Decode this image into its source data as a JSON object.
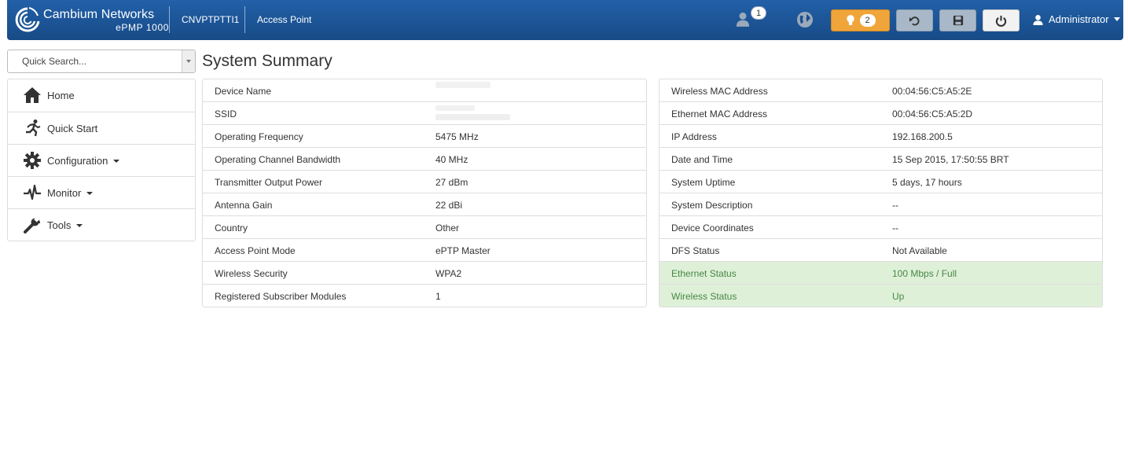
{
  "header": {
    "brand_name": "Cambium Networks",
    "brand_model": "ePMP 1000",
    "device_id": "CNVPTPTTI1",
    "device_mode": "Access Point",
    "connected_users_count": "1",
    "alerts_count": "2",
    "user_label": "Administrator",
    "colors": {
      "bar": "#1d4f8f",
      "alert_button": "#f0a53a",
      "action_button": "#a9b8c8"
    }
  },
  "search": {
    "placeholder": "Quick Search..."
  },
  "nav": {
    "items": [
      {
        "label": "Home",
        "icon": "home-icon",
        "has_dropdown": false
      },
      {
        "label": "Quick Start",
        "icon": "running-man-icon",
        "has_dropdown": false
      },
      {
        "label": "Configuration",
        "icon": "gear-icon",
        "has_dropdown": true
      },
      {
        "label": "Monitor",
        "icon": "pulse-icon",
        "has_dropdown": true
      },
      {
        "label": "Tools",
        "icon": "wrench-icon",
        "has_dropdown": true
      }
    ]
  },
  "main": {
    "title": "System Summary",
    "left_table": [
      {
        "key": "Device Name",
        "value": ""
      },
      {
        "key": "SSID",
        "value": ""
      },
      {
        "key": "Operating Frequency",
        "value": "5475 MHz"
      },
      {
        "key": "Operating Channel Bandwidth",
        "value": "40 MHz"
      },
      {
        "key": "Transmitter Output Power",
        "value": "27 dBm"
      },
      {
        "key": "Antenna Gain",
        "value": "22 dBi"
      },
      {
        "key": "Country",
        "value": "Other"
      },
      {
        "key": "Access Point Mode",
        "value": "ePTP Master"
      },
      {
        "key": "Wireless Security",
        "value": "WPA2"
      },
      {
        "key": "Registered Subscriber Modules",
        "value": "1"
      }
    ],
    "right_table": [
      {
        "key": "Wireless MAC Address",
        "value": "00:04:56:C5:A5:2E"
      },
      {
        "key": "Ethernet MAC Address",
        "value": "00:04:56:C5:A5:2D"
      },
      {
        "key": "IP Address",
        "value": "192.168.200.5"
      },
      {
        "key": "Date and Time",
        "value": "15 Sep 2015, 17:50:55 BRT"
      },
      {
        "key": "System Uptime",
        "value": "5 days, 17 hours"
      },
      {
        "key": "System Description",
        "value": "--"
      },
      {
        "key": "Device Coordinates",
        "value": "--"
      },
      {
        "key": "DFS Status",
        "value": "Not Available"
      },
      {
        "key": "Ethernet Status",
        "value": "100 Mbps / Full"
      },
      {
        "key": "Wireless Status",
        "value": "Up"
      }
    ],
    "status_color": "#dff0d8"
  }
}
